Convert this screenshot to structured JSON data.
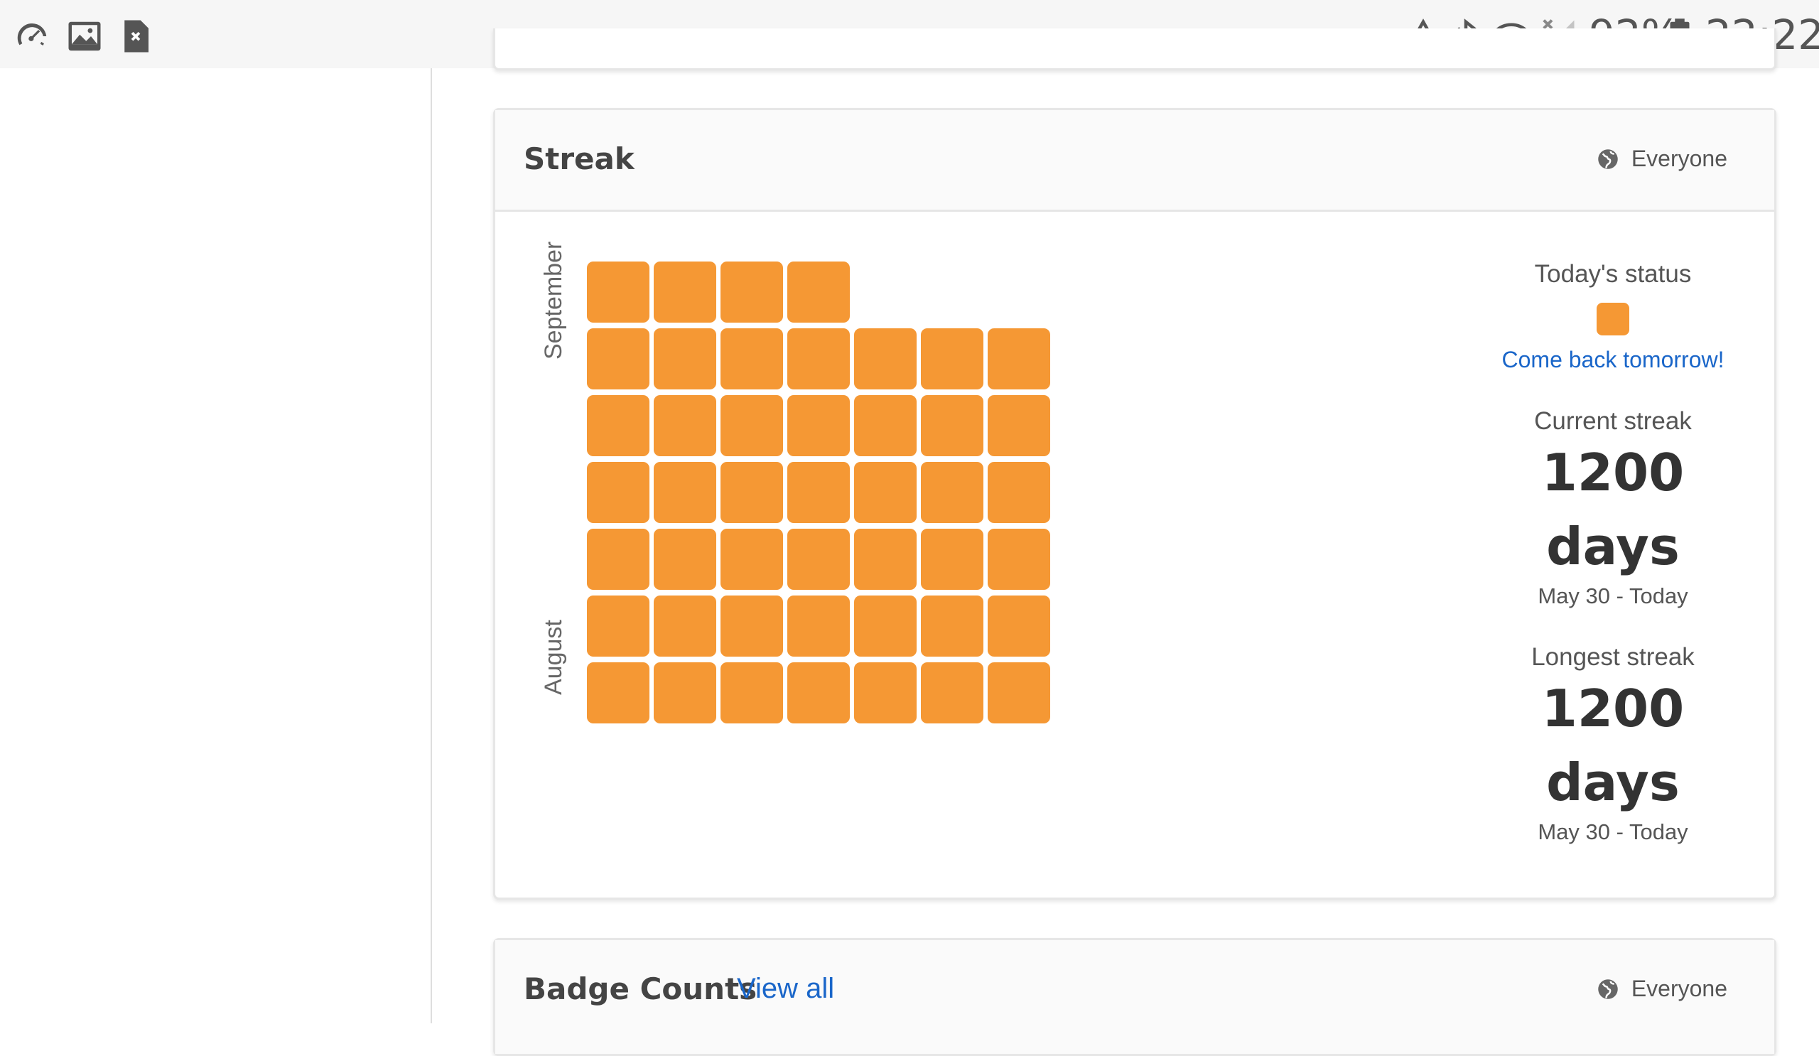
{
  "statusbar": {
    "left_icons": [
      "speedometer-icon",
      "image-icon",
      "file-x-icon"
    ],
    "right_icons": [
      "data-saver-icon",
      "bluetooth-icon",
      "wifi-icon",
      "no-signal-icon",
      "battery-icon"
    ],
    "battery": "92%",
    "time": "22:22"
  },
  "streak_card": {
    "title": "Streak",
    "visibility": "Everyone",
    "months": [
      "September",
      "August"
    ],
    "colors": {
      "active_day": "#f59834",
      "link": "#1a66c9"
    },
    "grid": {
      "columns": 7,
      "rows": [
        4,
        7,
        7,
        7,
        7,
        7,
        7
      ]
    },
    "today_status_label": "Today's status",
    "today_message": "Come back tomorrow!",
    "current_streak_label": "Current streak",
    "current_streak_value": "1200",
    "current_streak_unit": "days",
    "current_streak_range": "May 30 - Today",
    "longest_streak_label": "Longest streak",
    "longest_streak_value": "1200",
    "longest_streak_unit": "days",
    "longest_streak_range": "May 30 - Today"
  },
  "badge_card": {
    "title": "Badge Counts",
    "view_all": "View all",
    "visibility": "Everyone"
  }
}
